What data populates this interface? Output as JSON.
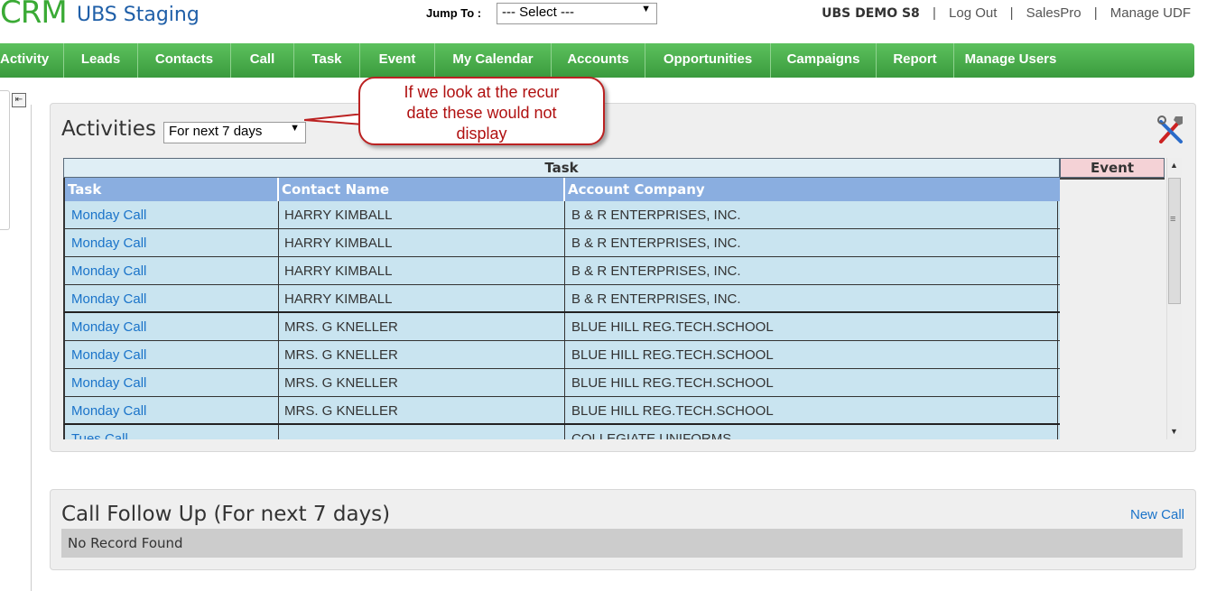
{
  "header": {
    "logo": "CRM",
    "app_title": "UBS Staging",
    "jump_label": "Jump To :",
    "jump_select": "--- Select ---",
    "user_name": "UBS DEMO S8",
    "logout": "Log Out",
    "salespro": "SalesPro",
    "manage_udf": "Manage UDF"
  },
  "nav": {
    "items": [
      {
        "label": "Activity"
      },
      {
        "label": "Leads"
      },
      {
        "label": "Contacts"
      },
      {
        "label": "Call"
      },
      {
        "label": "Task"
      },
      {
        "label": "Event"
      },
      {
        "label": "My Calendar"
      },
      {
        "label": "Accounts"
      },
      {
        "label": "Opportunities"
      },
      {
        "label": "Campaigns"
      },
      {
        "label": "Report"
      },
      {
        "label": "Manage Users"
      }
    ]
  },
  "activities": {
    "title": "Activities",
    "range": "For next 7 days",
    "task_group_header": "Task",
    "event_group_header": "Event",
    "columns": [
      "Task",
      "Contact Name",
      "Account Company"
    ],
    "rows": [
      {
        "task": "Monday Call",
        "contact": "HARRY KIMBALL",
        "company": "B & R ENTERPRISES, INC."
      },
      {
        "task": "Monday Call",
        "contact": "HARRY KIMBALL",
        "company": "B & R ENTERPRISES, INC."
      },
      {
        "task": "Monday Call",
        "contact": "HARRY KIMBALL",
        "company": "B & R ENTERPRISES, INC."
      },
      {
        "task": "Monday Call",
        "contact": "HARRY KIMBALL",
        "company": "B & R ENTERPRISES, INC."
      },
      {
        "task": "Monday Call",
        "contact": "MRS. G KNELLER",
        "company": "BLUE HILL REG.TECH.SCHOOL"
      },
      {
        "task": "Monday Call",
        "contact": "MRS. G KNELLER",
        "company": "BLUE HILL REG.TECH.SCHOOL"
      },
      {
        "task": "Monday Call",
        "contact": "MRS. G KNELLER",
        "company": "BLUE HILL REG.TECH.SCHOOL"
      },
      {
        "task": "Monday Call",
        "contact": "MRS. G KNELLER",
        "company": "BLUE HILL REG.TECH.SCHOOL"
      },
      {
        "task": "Tues Call",
        "contact": "",
        "company": "COLLEGIATE UNIFORMS"
      }
    ]
  },
  "callout": {
    "line1": "If we look at the recur",
    "line2": "date these would not",
    "line3": "display"
  },
  "followup": {
    "title": "Call Follow Up (For next 7 days)",
    "new_call": "New Call",
    "empty": "No Record Found"
  },
  "colors": {
    "nav_green": "#3a9a3d",
    "header_blue": "#8aaee0",
    "row_blue": "#c9e4f0",
    "link_blue": "#1a73c9",
    "event_pink": "#f4d2d6",
    "callout_red": "#b22222"
  }
}
